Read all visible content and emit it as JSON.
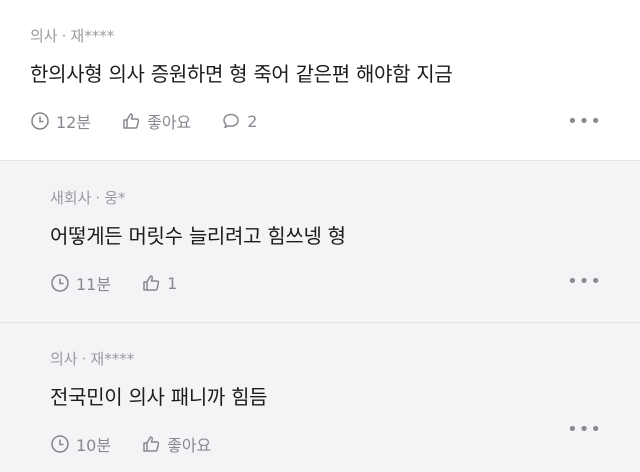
{
  "comments": [
    {
      "role": "의사",
      "author": "재****",
      "text": "한의사형 의사 증원하면 형 죽어 같은편 해야함 지금",
      "time": "12분",
      "like_label": "좋아요",
      "reply_count": "2"
    },
    {
      "role": "새회사",
      "author": "웅*",
      "text": "어떻게든 머릿수 늘리려고 힘쓰넹 형",
      "time": "11분",
      "like_count": "1"
    },
    {
      "role": "의사",
      "author": "재****",
      "text": "전국민이 의사 패니까 힘듬",
      "time": "10분",
      "like_label": "좋아요"
    }
  ],
  "separator": "·",
  "more_icon": "more-dots-icon",
  "colors": {
    "top_bg": "#ffffff",
    "reply_bg": "#f4f4f6",
    "meta": "#9a9aa0"
  }
}
